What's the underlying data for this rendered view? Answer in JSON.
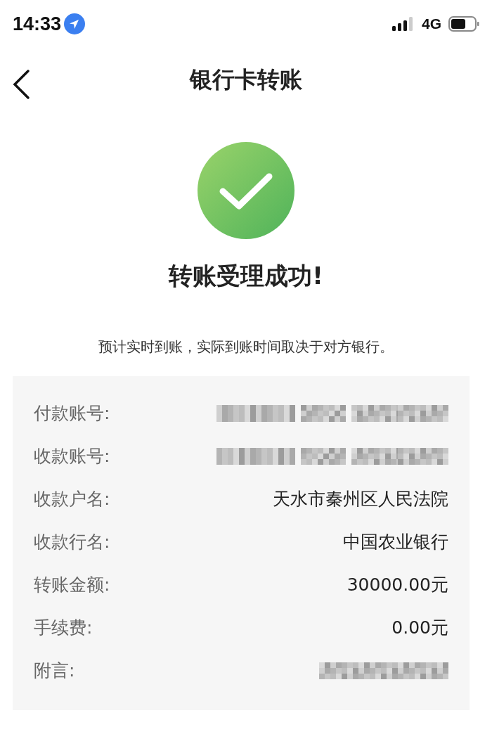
{
  "status_bar": {
    "time": "14:33",
    "network": "4G"
  },
  "nav": {
    "title": "银行卡转账"
  },
  "result": {
    "succeeded": true,
    "heading": "转账受理成功!",
    "note": "预计实时到账，实际到账时间取决于对方银行。"
  },
  "details": [
    {
      "label": "付款账号:",
      "kind": "masked_account"
    },
    {
      "label": "收款账号:",
      "kind": "masked_account"
    },
    {
      "label": "收款户名:",
      "kind": "text",
      "value": "天水市秦州区人民法院"
    },
    {
      "label": "收款行名:",
      "kind": "text",
      "value": "中国农业银行"
    },
    {
      "label": "转账金额:",
      "kind": "text",
      "value": "30000.00元"
    },
    {
      "label": "手续费:",
      "kind": "text",
      "value": "0.00元"
    },
    {
      "label": "附言:",
      "kind": "masked_note"
    }
  ]
}
